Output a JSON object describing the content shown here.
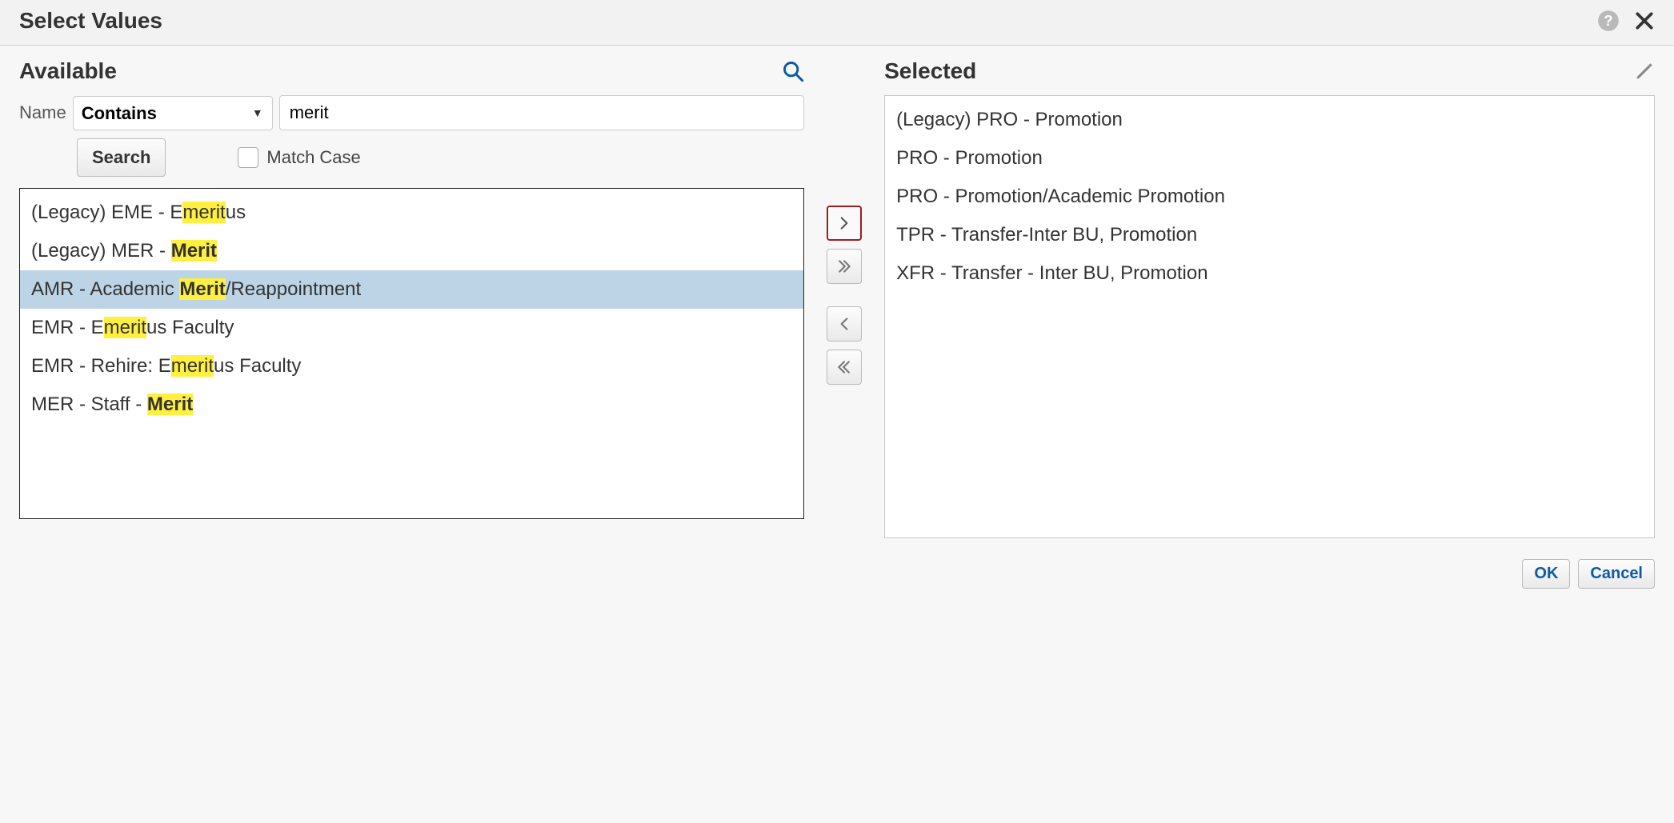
{
  "dialog": {
    "title": "Select Values"
  },
  "available": {
    "heading": "Available",
    "filter_label": "Name",
    "filter_operator_selected": "Contains",
    "filter_value": "merit",
    "search_button": "Search",
    "match_case_label": "Match Case",
    "match_case_checked": false,
    "items": [
      {
        "parts": [
          {
            "t": "(Legacy) EME - E"
          },
          {
            "t": "merit",
            "hl": true
          },
          {
            "t": "us"
          }
        ],
        "selected": false
      },
      {
        "parts": [
          {
            "t": "(Legacy) MER - "
          },
          {
            "t": "Merit",
            "hl": true,
            "bold": true
          }
        ],
        "selected": false
      },
      {
        "parts": [
          {
            "t": "AMR - Academic "
          },
          {
            "t": "Merit",
            "hl": true,
            "bold": true
          },
          {
            "t": "/Reappointment"
          }
        ],
        "selected": true
      },
      {
        "parts": [
          {
            "t": "EMR - E"
          },
          {
            "t": "merit",
            "hl": true
          },
          {
            "t": "us Faculty"
          }
        ],
        "selected": false
      },
      {
        "parts": [
          {
            "t": "EMR - Rehire: E"
          },
          {
            "t": "merit",
            "hl": true
          },
          {
            "t": "us Faculty"
          }
        ],
        "selected": false
      },
      {
        "parts": [
          {
            "t": "MER - Staff - "
          },
          {
            "t": "Merit",
            "hl": true,
            "bold": true
          }
        ],
        "selected": false
      }
    ]
  },
  "shuttle": {
    "move_right": "Move selected to Selected list",
    "move_all_right": "Move all to Selected list",
    "move_left": "Remove from Selected list",
    "move_all_left": "Remove all from Selected list"
  },
  "selected": {
    "heading": "Selected",
    "items": [
      "(Legacy) PRO - Promotion",
      "PRO - Promotion",
      "PRO - Promotion/Academic Promotion",
      "TPR - Transfer-Inter BU, Promotion",
      "XFR - Transfer - Inter BU, Promotion"
    ]
  },
  "footer": {
    "ok": "OK",
    "cancel": "Cancel"
  }
}
